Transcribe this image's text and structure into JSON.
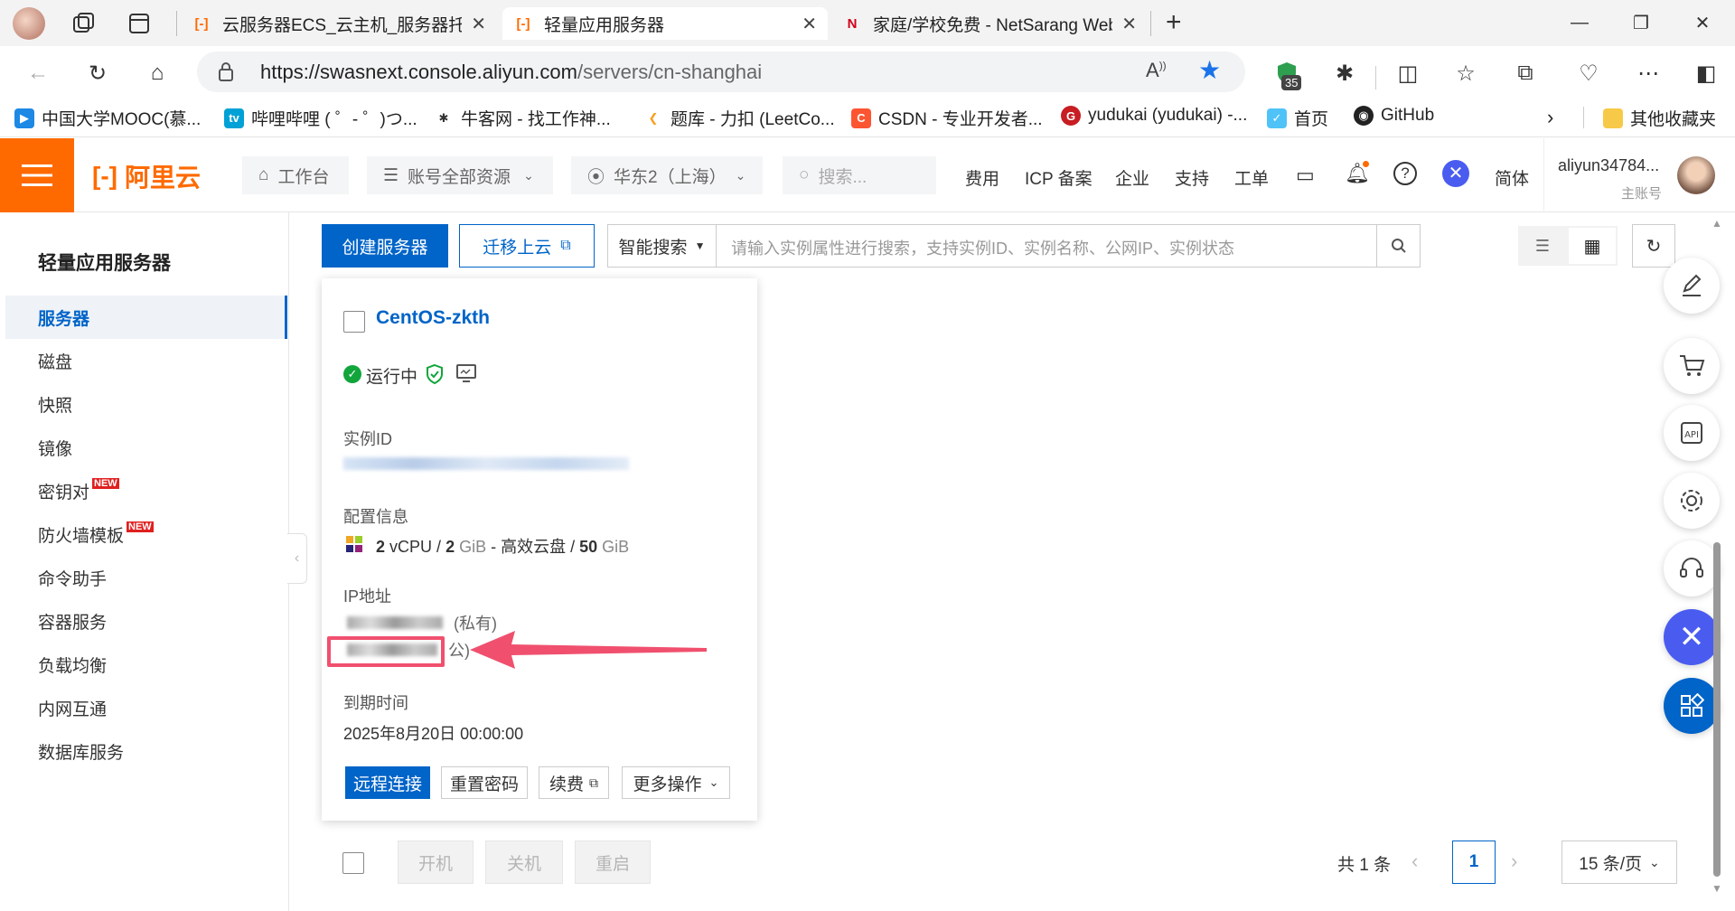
{
  "browser": {
    "tabs": [
      {
        "title": "云服务器ECS_云主机_服务器托管",
        "active": false
      },
      {
        "title": "轻量应用服务器",
        "active": true
      },
      {
        "title": "家庭/学校免费 - NetSarang Web",
        "active": false
      }
    ],
    "url_host": "https://swasnext.console.aliyun.com",
    "url_path": "/servers/cn-shanghai",
    "extension_badge": "35",
    "bookmarks": [
      "中国大学MOOC(慕...",
      "哔哩哔哩 ( ゜- ゜)つ...",
      "牛客网 - 找工作神...",
      "题库 - 力扣 (LeetCo...",
      "CSDN - 专业开发者...",
      "yudukai (yudukai) -...",
      "首页",
      "GitHub"
    ],
    "other_bookmarks": "其他收藏夹"
  },
  "console": {
    "logo_text": "阿里云",
    "workbench": "工作台",
    "resources": "账号全部资源",
    "region": "华东2（上海）",
    "search_placeholder": "搜索...",
    "links": [
      "费用",
      "ICP 备案",
      "企业",
      "支持",
      "工单"
    ],
    "lang": "简体",
    "account_name": "aliyun34784...",
    "account_role": "主账号"
  },
  "sidebar": {
    "title": "轻量应用服务器",
    "items": [
      {
        "label": "服务器",
        "active": true,
        "badge": ""
      },
      {
        "label": "磁盘",
        "active": false,
        "badge": ""
      },
      {
        "label": "快照",
        "active": false,
        "badge": ""
      },
      {
        "label": "镜像",
        "active": false,
        "badge": ""
      },
      {
        "label": "密钥对",
        "active": false,
        "badge": "NEW"
      },
      {
        "label": "防火墙模板",
        "active": false,
        "badge": "NEW"
      },
      {
        "label": "命令助手",
        "active": false,
        "badge": ""
      },
      {
        "label": "容器服务",
        "active": false,
        "badge": ""
      },
      {
        "label": "负载均衡",
        "active": false,
        "badge": ""
      },
      {
        "label": "内网互通",
        "active": false,
        "badge": ""
      },
      {
        "label": "数据库服务",
        "active": false,
        "badge": ""
      }
    ]
  },
  "toolbar": {
    "create_button": "创建服务器",
    "migrate_button": "迁移上云",
    "smart_search": "智能搜索",
    "search_placeholder": "请输入实例属性进行搜索，支持实例ID、实例名称、公网IP、实例状态"
  },
  "instance": {
    "name": "CentOS-zkth",
    "status": "运行中",
    "id_label": "实例ID",
    "config_label": "配置信息",
    "cpu": "2",
    "cpu_unit": "vCPU",
    "mem": "2",
    "mem_unit": "GiB",
    "disk_type": "高效云盘",
    "disk": "50",
    "disk_unit": "GiB",
    "ip_label": "IP地址",
    "private_suffix": "(私有)",
    "public_suffix": "公)",
    "expire_label": "到期时间",
    "expire_value": "2025年8月20日 00:00:00",
    "actions": {
      "remote": "远程连接",
      "reset_password": "重置密码",
      "renew": "续费",
      "more": "更多操作"
    }
  },
  "footer": {
    "start": "开机",
    "stop": "关机",
    "restart": "重启",
    "total": "共 1 条",
    "current_page": "1",
    "page_size": "15 条/页"
  },
  "colors": {
    "brand_orange": "#ff6a00",
    "primary_blue": "#0064c8",
    "status_green": "#12a53c",
    "highlight_red": "#f0506e"
  }
}
